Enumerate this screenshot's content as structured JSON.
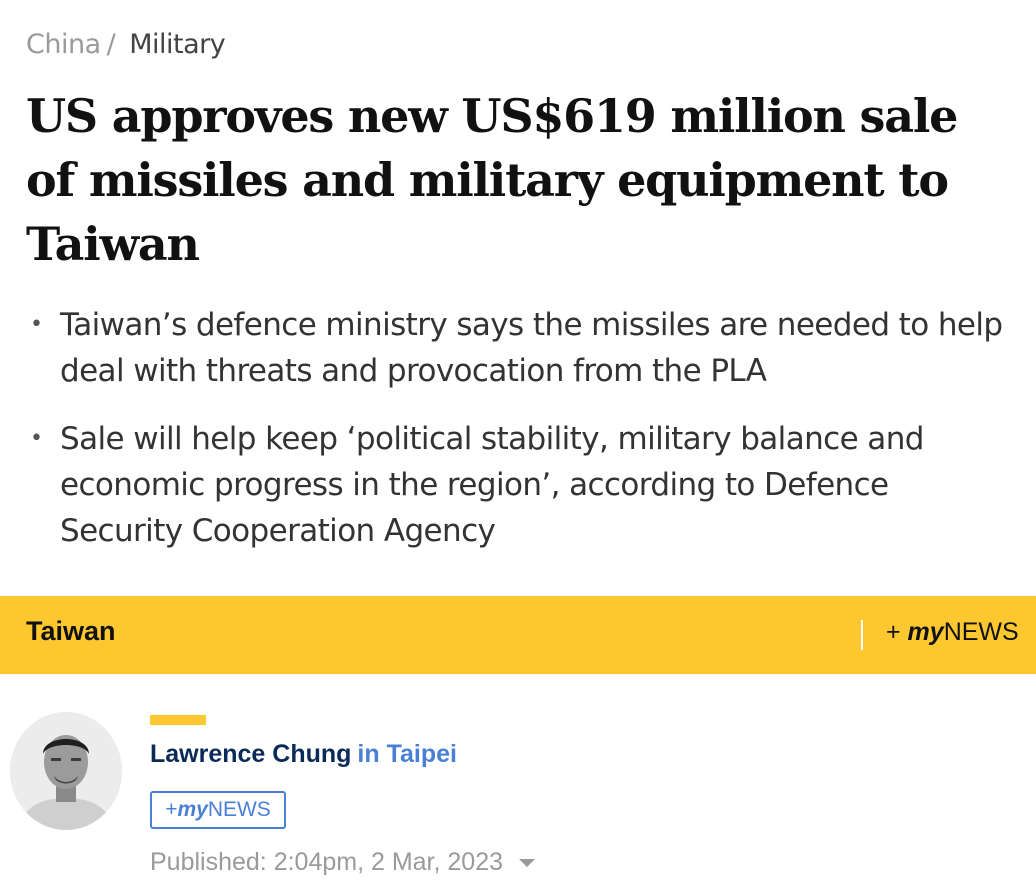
{
  "breadcrumb": {
    "parent": "China",
    "separator": "/",
    "current": "Military"
  },
  "article": {
    "headline": "US approves new US$619 million sale of missiles and military equipment to Taiwan",
    "summary": [
      "Taiwan’s defence ministry says the missiles are needed to help deal with threats and provocation from the PLA",
      "Sale will help keep ‘political stability, military balance and economic progress in the region’, according to Defence Security Cooperation Agency"
    ]
  },
  "topic_bar": {
    "topic": "Taiwan",
    "follow_prefix": "+ ",
    "follow_my": "my",
    "follow_news": "NEWS",
    "background_color": "#fdc82f"
  },
  "author": {
    "name": "Lawrence Chung",
    "location": "in Taipei",
    "avatar_icon": "author-headshot",
    "follow_prefix": "+ ",
    "follow_my": "my",
    "follow_news": "NEWS",
    "name_color": "#0a2a57",
    "link_color": "#4a7fd6"
  },
  "meta": {
    "published": "Published: 2:04pm, 2 Mar, 2023",
    "dropdown_icon": "chevron-down-icon"
  }
}
